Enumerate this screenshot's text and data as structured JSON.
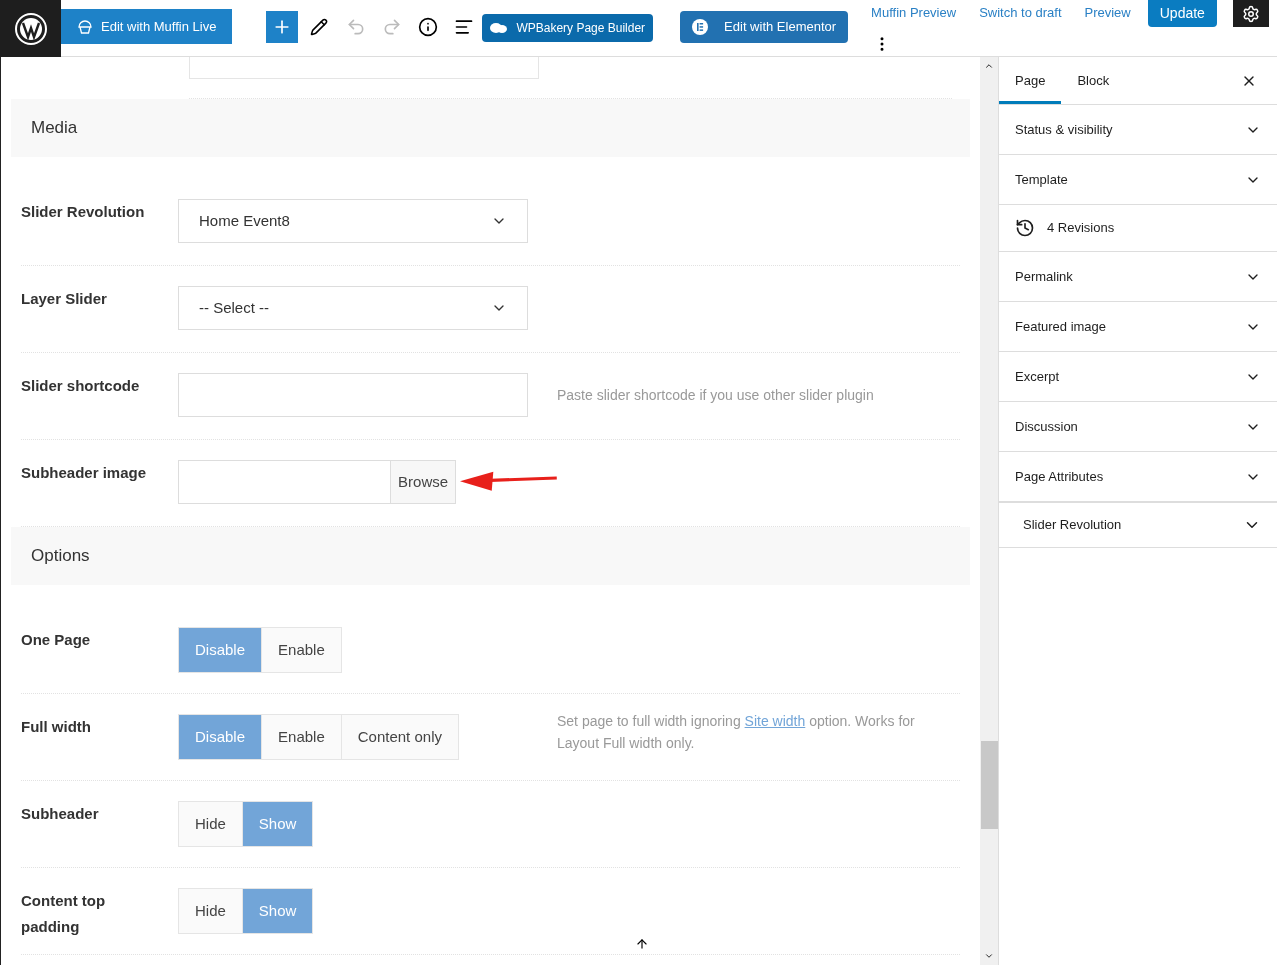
{
  "toolbar": {
    "muffin_button": "Edit with Muffin Live",
    "wpbakery_button": "WPBakery Page Builder",
    "elementor_button": "Edit with Elementor",
    "links": [
      "Muffin Preview",
      "Switch to draft",
      "Preview"
    ],
    "update_button": "Update"
  },
  "sections": [
    {
      "title": "Media",
      "rows": [
        {
          "kind": "select",
          "label": "Slider Revolution",
          "value": "Home Event8"
        },
        {
          "kind": "select",
          "label": "Layer Slider",
          "value": "-- Select --"
        },
        {
          "kind": "text",
          "label": "Slider shortcode",
          "hint": "Paste slider shortcode if you use other slider plugin"
        },
        {
          "kind": "browse",
          "label": "Subheader image",
          "button": "Browse",
          "annotated": true
        }
      ]
    },
    {
      "title": "Options",
      "rows": [
        {
          "kind": "segmented",
          "label": "One Page",
          "options": [
            {
              "label": "Disable",
              "selected": true
            },
            {
              "label": "Enable",
              "selected": false
            }
          ]
        },
        {
          "kind": "segmented",
          "label": "Full width",
          "options": [
            {
              "label": "Disable",
              "selected": true
            },
            {
              "label": "Enable",
              "selected": false
            },
            {
              "label": "Content only",
              "selected": false
            }
          ],
          "hint_parts": [
            "Set page to full width ignoring ",
            "Site width",
            " option. Works for Layout Full width only."
          ]
        },
        {
          "kind": "segmented",
          "label": "Subheader",
          "options": [
            {
              "label": "Hide",
              "selected": false
            },
            {
              "label": "Show",
              "selected": true
            }
          ]
        },
        {
          "kind": "segmented",
          "label": "Content top padding",
          "options": [
            {
              "label": "Hide",
              "selected": false
            },
            {
              "label": "Show",
              "selected": true
            }
          ]
        }
      ]
    }
  ],
  "sidebar": {
    "tabs": [
      {
        "label": "Page",
        "selected": true
      },
      {
        "label": "Block",
        "selected": false
      }
    ],
    "panels": [
      {
        "kind": "panel",
        "label": "Status & visibility"
      },
      {
        "kind": "panel",
        "label": "Template"
      },
      {
        "kind": "revisions",
        "label": "4 Revisions"
      },
      {
        "kind": "panel",
        "label": "Permalink"
      },
      {
        "kind": "panel",
        "label": "Featured image"
      },
      {
        "kind": "panel",
        "label": "Excerpt"
      },
      {
        "kind": "panel",
        "label": "Discussion"
      },
      {
        "kind": "panel",
        "label": "Page Attributes"
      },
      {
        "kind": "metabox",
        "label": "Slider Revolution"
      }
    ]
  }
}
